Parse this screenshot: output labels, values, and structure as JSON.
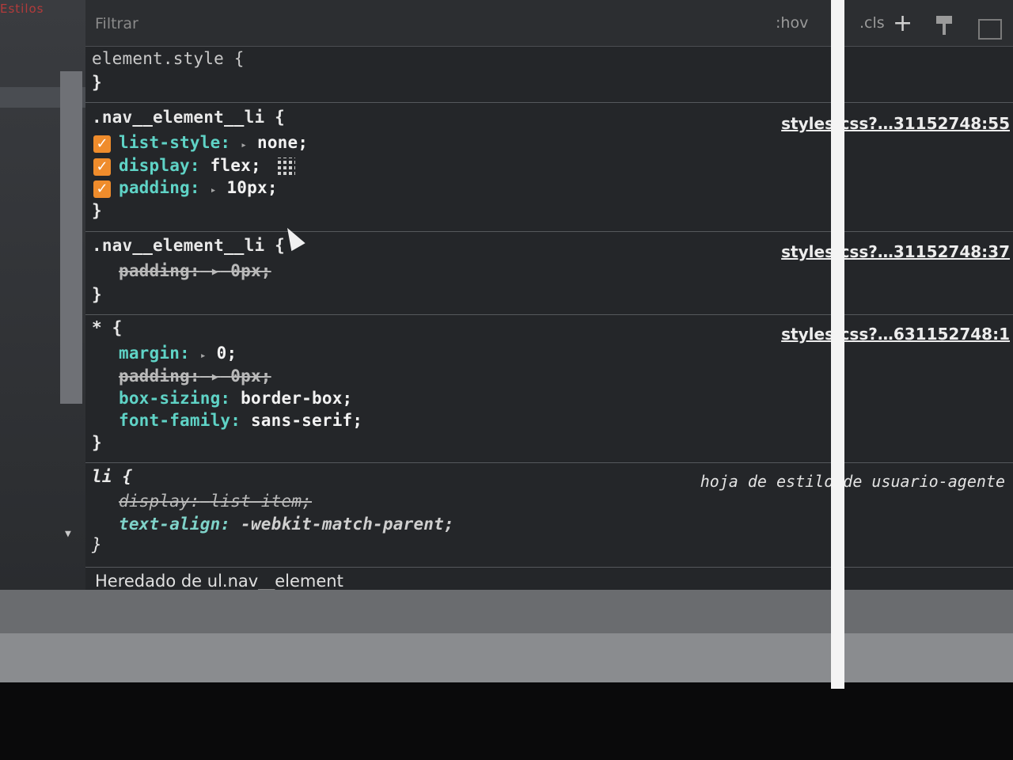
{
  "sidebar": {
    "label": "Estilos"
  },
  "toolbar": {
    "filter_placeholder": "Filtrar",
    "hov_label": ":hov",
    "cls_label": ".cls",
    "add_rule_label": "+"
  },
  "rules": {
    "element_style": {
      "selector": "element.style {",
      "close": "}"
    },
    "nav_li_1": {
      "selector": ".nav__element__li {",
      "source": "styles.css?…31152748:55",
      "p1_name": "list-style:",
      "p1_value": "none;",
      "p2_name": "display:",
      "p2_value": "flex;",
      "p3_name": "padding:",
      "p3_value": "10px;",
      "close": "}"
    },
    "nav_li_2": {
      "selector": ".nav__element__li {",
      "source": "styles.css?…31152748:37",
      "p1_name": "padding:",
      "p1_value": "0px;",
      "close": "}"
    },
    "universal": {
      "selector": "* {",
      "source": "styles.css?…631152748:1",
      "p1_name": "margin:",
      "p1_value": "0;",
      "p2_name": "padding:",
      "p2_value": "0px;",
      "p3_name": "box-sizing:",
      "p3_value": "border-box;",
      "p4_name": "font-family:",
      "p4_value": "sans-serif;",
      "close": "}"
    },
    "li_ua": {
      "selector": "li {",
      "source": "hoja de estilo de usuario-agente",
      "p1_name": "display:",
      "p1_value": "list-item;",
      "p2_name": "text-align:",
      "p2_value": "-webkit-match-parent;",
      "close": "}"
    }
  },
  "inherited_label": "Heredado de ul.nav__element"
}
